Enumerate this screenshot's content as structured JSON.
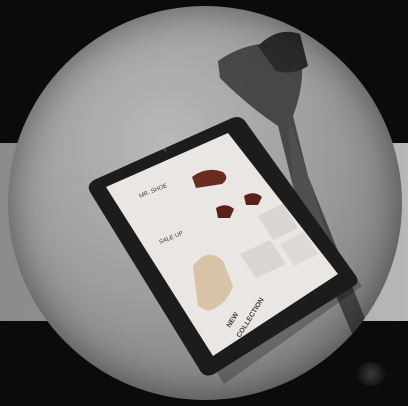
{
  "tablet_screen": {
    "header_left": "MR. SHOE",
    "promo_label": "SALE UP",
    "collection_line1": "NEW",
    "collection_line2": "COLLECTION"
  }
}
